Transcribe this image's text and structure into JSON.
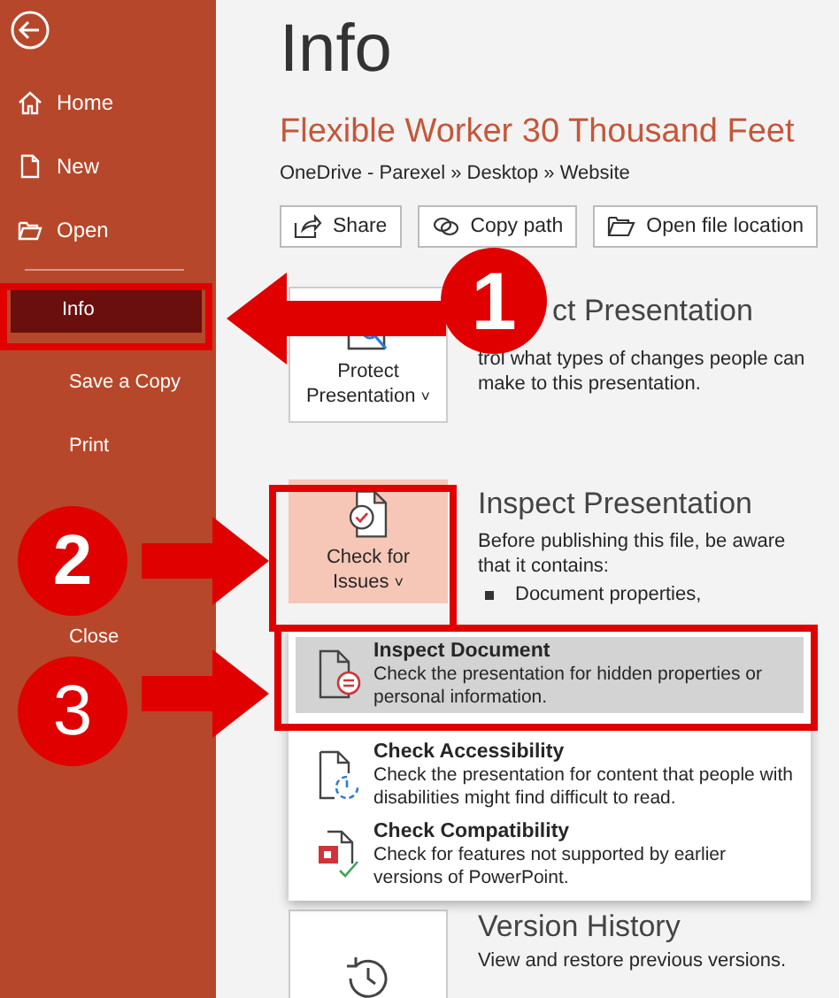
{
  "sidebar": {
    "top_items": [
      {
        "label": "Home"
      },
      {
        "label": "New"
      },
      {
        "label": "Open"
      }
    ],
    "bottom_items": [
      {
        "label": "Info",
        "selected": true
      },
      {
        "label": "Save a Copy",
        "selected": false
      },
      {
        "label": "Print",
        "selected": false
      },
      {
        "label": "Close",
        "selected": false
      }
    ]
  },
  "page_title": "Info",
  "document": {
    "title": "Flexible Worker 30 Thousand Feet",
    "path": "OneDrive - Parexel » Desktop » Website"
  },
  "actions": [
    "Share",
    "Copy path",
    "Open file location"
  ],
  "sections": [
    {
      "button": "Protect Presentation",
      "caret": "˅",
      "heading": "ct Presentation",
      "description": "trol what types of changes people can make to this presentation."
    },
    {
      "button": "Check for Issues",
      "caret": "˅",
      "heading": "Inspect Presentation",
      "description": "Before publishing this file, be aware that it contains:",
      "bullets": [
        "Document properties,"
      ]
    },
    {
      "heading": "Version History",
      "description": "View and restore previous versions."
    }
  ],
  "menu": [
    {
      "title": "Inspect Document",
      "description": "Check the presentation for hidden properties or personal information.",
      "selected": true
    },
    {
      "title": "Check Accessibility",
      "description": "Check the presentation for content that people with disabilities might find difficult to read.",
      "selected": false
    },
    {
      "title": "Check Compatibility",
      "description": "Check for features not supported by earlier versions of PowerPoint.",
      "selected": false
    }
  ],
  "callouts": [
    "1",
    "2",
    "3"
  ]
}
